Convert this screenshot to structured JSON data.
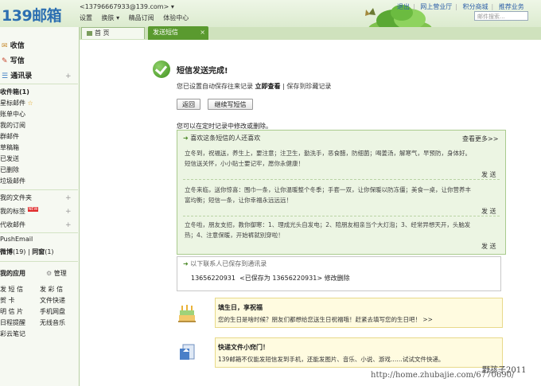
{
  "header": {
    "logo_num": "139",
    "logo_text": "邮箱",
    "account": "<13796667933@139.com>",
    "account_arrow": "▾",
    "links": [
      "设置",
      "换肤 ▾",
      "精品订阅",
      "体验中心"
    ],
    "right_links": [
      "退出",
      "网上营业厅",
      "积分商城",
      "推荐业务"
    ],
    "search_placeholder": "邮件搜索..."
  },
  "tabs": {
    "home": "首 页",
    "active": "发送短信",
    "close": "×"
  },
  "sidebar": {
    "inbox": "收信",
    "compose": "写信",
    "contacts": "通讯录",
    "folders": [
      "收件箱(1)",
      "星标邮件",
      "账单中心",
      "我的订阅",
      "群邮件",
      "草稿箱",
      "已发送",
      "已删除",
      "垃圾邮件"
    ],
    "my_folders": "我的文件夹",
    "my_tags": "我的标签",
    "new_badge": "NEW",
    "proxy": "代收邮件",
    "pushemail": "PushEmail",
    "weibo": "微博",
    "weibo_count": "(19)",
    "circle": "同窗",
    "circle_count": "(1)",
    "apps_title": "我的应用",
    "manage": "管理",
    "apps": [
      [
        "发 短 信",
        "发 彩 信"
      ],
      [
        "贺    卡",
        "文件快递"
      ],
      [
        "明 信 片",
        "手机网盘"
      ],
      [
        "日程提醒",
        "无线音乐"
      ],
      [
        "彩云笔记",
        ""
      ]
    ]
  },
  "result": {
    "title": "短信发送完成!",
    "save_info_pre": "您已设置自动保存往来记录",
    "save_info_link": "立即查看",
    "save_info_sep": "|",
    "save_info_post": "保存到珍藏记录",
    "back_button": "返回",
    "continue_button": "继续写短信",
    "timing_note": "您可以在定时记录中修改或删除。"
  },
  "recommend": {
    "title": "喜欢这条短信的人还喜欢",
    "more": "查看更多>>",
    "send_label": "发 送",
    "messages": [
      [
        "立冬到，祝福送，养生上，要注意；注卫生，勤洗手，恶食醋，防细菌；喝姜汤，解寒气，早预防，身体好。",
        "短信送关怀，小小贴士要记牢，愿你永健康！"
      ],
      [
        "立冬来临，送你惊喜：围巾一条，让你温暖整个冬季；手套一双，让你保暖以防冻僵；美食一桌，让你营养丰",
        "富均衡；短信一条，让你幸福永远远远！"
      ],
      [
        "立冬啦，朋友支招，教你御寒：1、理成光头自发电；2、陪朋友相亲当个大灯泡；3、经常异想天开，头脑发",
        "热；4、注意保暖，开始裤就别穿啦！"
      ]
    ]
  },
  "saved_contacts": {
    "title": "以下联系人已保存到通讯录",
    "number": "13656220931",
    "saved_as": "<已保存为 13656220931>",
    "edit_delete": "修改删除"
  },
  "tips": [
    {
      "title": "填生日，享祝福",
      "body": "您的生日是啥时候？朋友们都想给您送生日祝福哦！赶紧去填写您的生日吧！ >>"
    },
    {
      "title": "快递文件小窍门！",
      "body": "139邮箱不仅能发短信发到手机，还能发图片、音乐、小说、游戏……试试文件快递。"
    }
  ],
  "watermark": "http://home.zhubajie.com/6770690/",
  "signature": "野孩子2011"
}
